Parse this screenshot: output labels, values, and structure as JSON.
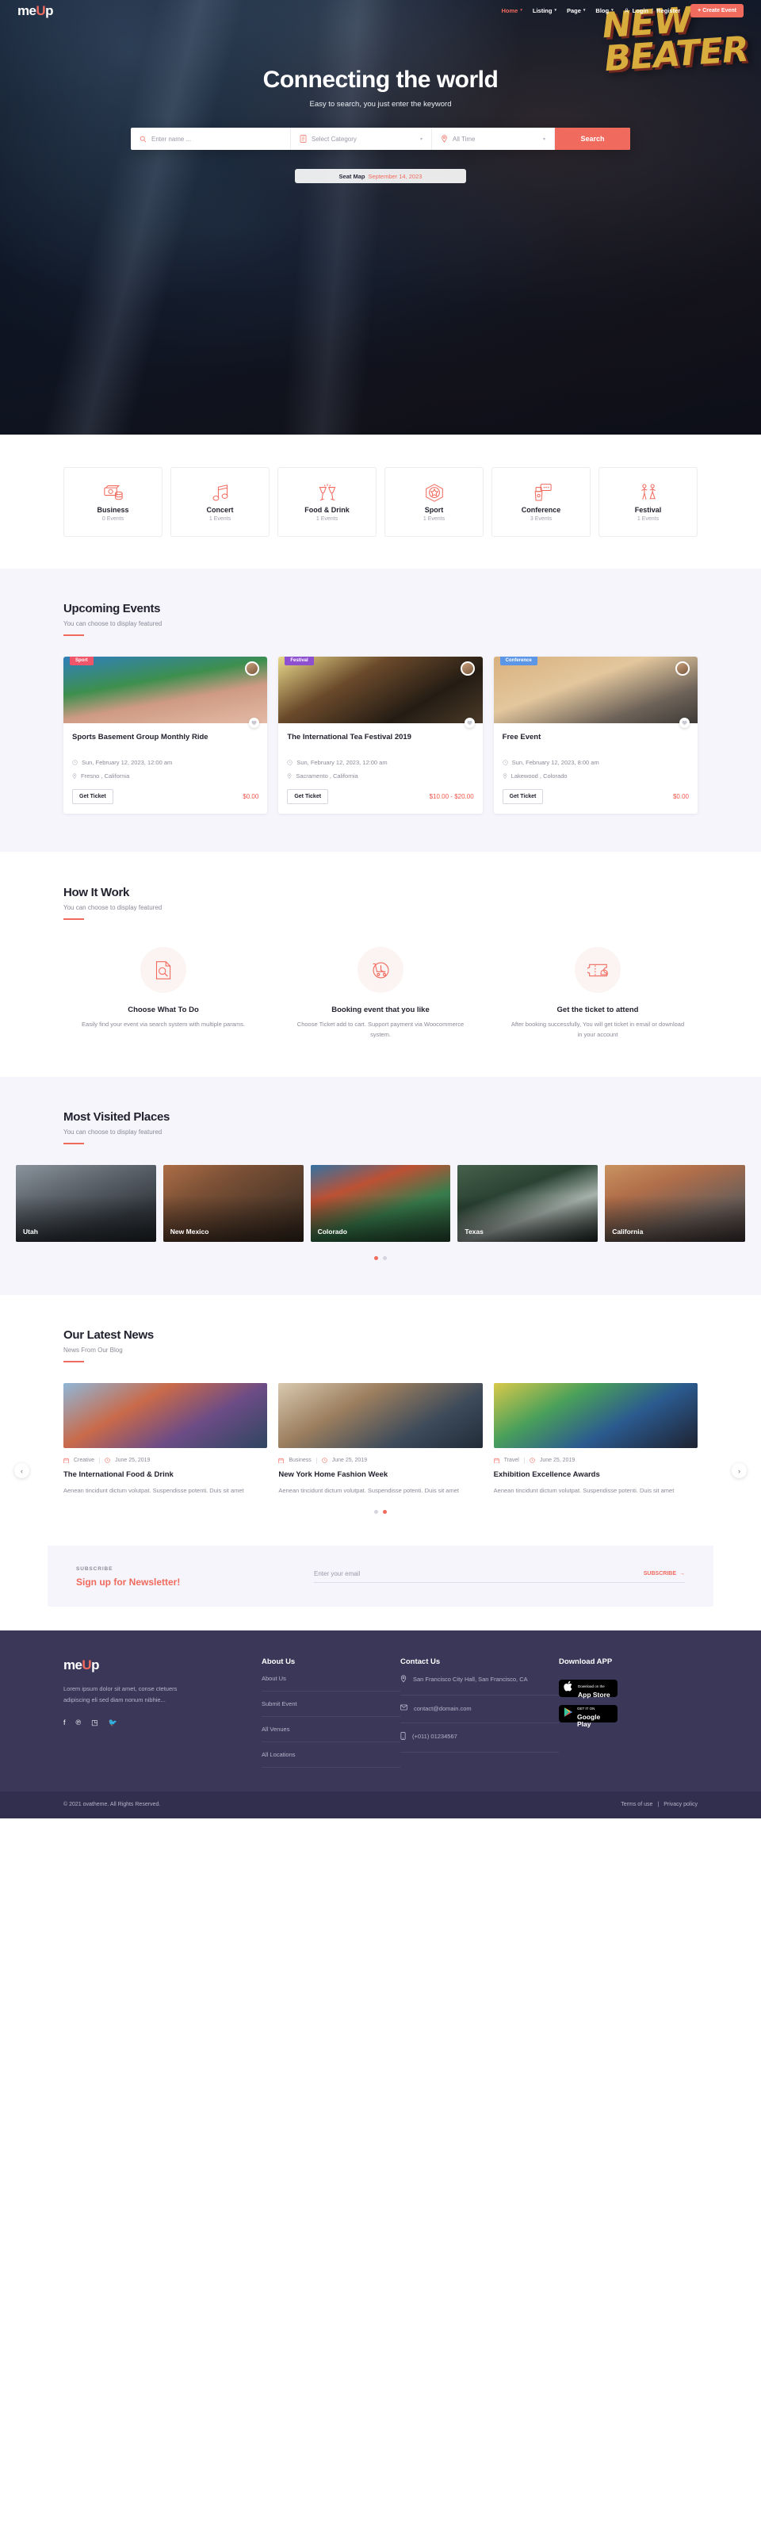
{
  "brand": {
    "name_part1": "me",
    "name_part2": "U",
    "name_part3": "p"
  },
  "nav": {
    "items": [
      {
        "label": "Home",
        "caret": "▾",
        "active": true
      },
      {
        "label": "Listing",
        "caret": "▾",
        "active": false
      },
      {
        "label": "Page",
        "caret": "▾",
        "active": false
      },
      {
        "label": "Blog",
        "caret": "▾",
        "active": false
      }
    ],
    "login": "Login",
    "separator": "|",
    "register": "Register",
    "create_event": "+ Create Event"
  },
  "hero": {
    "graffiti_line1": "NEW",
    "graffiti_line2": "BEATER",
    "title": "Connecting the world",
    "subtitle": "Easy to search, you just enter the keyword",
    "search": {
      "name_placeholder": "Enter name ...",
      "category_value": "Select Category",
      "time_value": "All Time",
      "button": "Search"
    },
    "seatmap_label": "Seat Map",
    "seatmap_date": "September 14, 2023"
  },
  "categories": [
    {
      "name": "Business",
      "count": "0  Events",
      "icon": "money-icon"
    },
    {
      "name": "Concert",
      "count": "1  Events",
      "icon": "music-note-icon"
    },
    {
      "name": "Food & Drink",
      "count": "1  Events",
      "icon": "cheers-glasses-icon"
    },
    {
      "name": "Sport",
      "count": "1  Events",
      "icon": "medal-icon"
    },
    {
      "name": "Conference",
      "count": "3  Events",
      "icon": "podium-icon"
    },
    {
      "name": "Festival",
      "count": "1  Events",
      "icon": "dancers-icon"
    }
  ],
  "upcoming": {
    "title": "Upcoming Events",
    "subtitle": "You can choose to display featured",
    "prev_arrow": "‹",
    "next_arrow": "›",
    "events": [
      {
        "badge": "Sport",
        "title": "Sports Basement Group Monthly Ride",
        "date": "Sun, February 12, 2023, 12:00 am",
        "location": "Fresno , California",
        "button": "Get Ticket",
        "price": "$0.00"
      },
      {
        "badge": "Festival",
        "title": "The International Tea Festival 2019",
        "date": "Sun, February 12, 2023, 12:00 am",
        "location": "Sacramento , California",
        "button": "Get Ticket",
        "price": "$10.00 - $20.00"
      },
      {
        "badge": "Conference",
        "title": "Free Event",
        "date": "Sun, February 12, 2023, 8:00 am",
        "location": "Lakewood , Colorado",
        "button": "Get Ticket",
        "price": "$0.00"
      }
    ]
  },
  "how": {
    "title": "How It Work",
    "subtitle": "You can choose to display featured",
    "steps": [
      {
        "icon": "search-doc-icon",
        "title": "Choose What To Do",
        "text": "Easily find your event via search system with multiple params."
      },
      {
        "icon": "cart-clock-icon",
        "title": "Booking event that you like",
        "text": "Choose Ticket add to cart. Support payment via Woocommerce system."
      },
      {
        "icon": "ticket-bell-icon",
        "title": "Get the ticket to attend",
        "text": "After booking successfully, You will get ticket in email or download in your account"
      }
    ]
  },
  "places": {
    "title": "Most Visited Places",
    "subtitle": "You can choose to display featured",
    "items": [
      {
        "name": "Utah"
      },
      {
        "name": "New Mexico"
      },
      {
        "name": "Colorado"
      },
      {
        "name": "Texas"
      },
      {
        "name": "California"
      }
    ],
    "dots": 2,
    "active_dot": 0
  },
  "news": {
    "title": "Our Latest News",
    "subtitle": "News From Our Blog",
    "posts": [
      {
        "category": "Creative",
        "date": "June 25, 2019",
        "title": "The International Food & Drink",
        "excerpt": "Aenean tincidunt dictum volutpat. Suspendisse potenti. Duis sit amet"
      },
      {
        "category": "Business",
        "date": "June 25, 2019",
        "title": "New York Home Fashion Week",
        "excerpt": "Aenean tincidunt dictum volutpat. Suspendisse potenti. Duis sit amet"
      },
      {
        "category": "Travel",
        "date": "June 25, 2019",
        "title": "Exhibition Excellence Awards",
        "excerpt": "Aenean tincidunt dictum volutpat. Suspendisse potenti. Duis sit amet"
      }
    ],
    "dots": 2,
    "active_dot": 1
  },
  "newsletter": {
    "kicker": "SUBSCRIBE",
    "headline": "Sign up for Newsletter!",
    "placeholder": "Enter your email",
    "button": "SUBSCRIBE",
    "button_arrow": "→"
  },
  "footer": {
    "description": "Lorem ipsum dolor sit amet, conse ctetuers adipiscing eli sed diam nonum nibhie...",
    "social": [
      {
        "icon": "facebook-icon",
        "glyph": "f"
      },
      {
        "icon": "pinterest-icon",
        "glyph": "℗"
      },
      {
        "icon": "instagram-icon",
        "glyph": "◳"
      },
      {
        "icon": "twitter-icon",
        "glyph": "🐦"
      }
    ],
    "about": {
      "heading": "About Us",
      "links": [
        "About Us",
        "Submit Event",
        "All Venues",
        "All Locations"
      ]
    },
    "contact": {
      "heading": "Contact Us",
      "address": "San Francisco City Hall, San Francisco, CA",
      "email": "contact@domain.com",
      "phone": "(+011) 01234567"
    },
    "download": {
      "heading": "Download APP",
      "appstore_small": "Download on the",
      "appstore_big": "App Store",
      "google_small": "GET IT ON",
      "google_big": "Google Play"
    },
    "copyright": "© 2021 ovatheme. All Rights Reserved.",
    "terms": "Terms of use",
    "divider": "|",
    "privacy": "Privacy policy"
  },
  "colors": {
    "accent": "#f16a5e",
    "dark": "#3b3759",
    "lightbg": "#f5f5fb"
  }
}
